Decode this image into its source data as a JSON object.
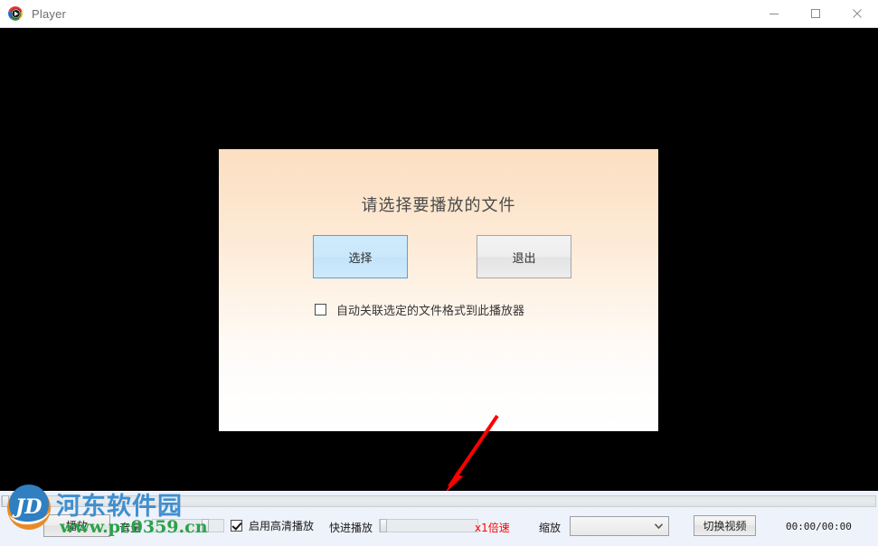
{
  "window": {
    "title": "Player",
    "app_icon": "player-disc-icon",
    "minimize_label": "—",
    "maximize_label": "□",
    "close_label": "✕"
  },
  "dialog": {
    "title": "请选择要播放的文件",
    "select_button": "选择",
    "exit_button": "退出",
    "associate_checkbox_label": "自动关联选定的文件格式到此播放器",
    "associate_checked": false,
    "accent_color": "#5c9fd4",
    "background_top": "#fbdfc1",
    "background_bottom": "#ffffff"
  },
  "controls": {
    "seek_position_percent": 0,
    "play_button": "播放",
    "volume_label": "音量",
    "volume_percent": 68,
    "hd_checkbox_label": "启用高清播放",
    "hd_checked": true,
    "fast_forward_label": "快进播放",
    "fast_forward_percent": 0,
    "speed_label": "x1倍速",
    "speed_color": "#ff0000",
    "zoom_label": "缩放",
    "zoom_value": "",
    "zoom_dropdown_icon": "chevron-down-icon",
    "switch_video_button": "切换视频",
    "time_display": "00:00/00:00"
  },
  "annotation": {
    "arrow_color": "#ff0000",
    "arrow_icon": "red-arrow-pointer"
  },
  "watermark": {
    "site_name": "河东软件园",
    "site_url": "www.pc0359.cn",
    "logo_icon": "hedong-logo-icon",
    "title_color": "#3f8fd0",
    "url_color": "#2aa24a"
  }
}
